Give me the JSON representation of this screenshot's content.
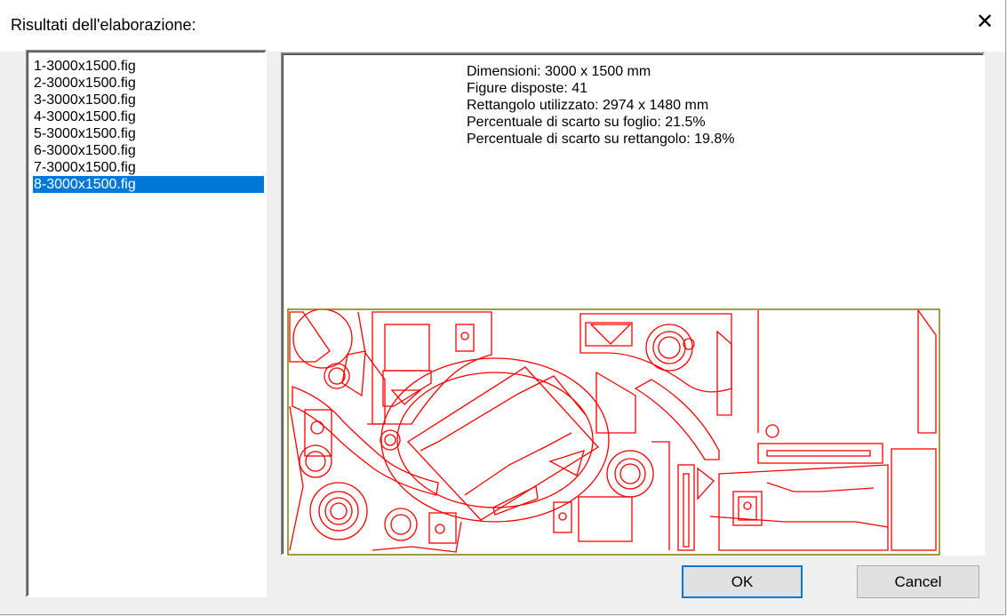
{
  "dialog": {
    "title": "Risultati dell'elaborazione:",
    "close_glyph": "✕"
  },
  "file_list": {
    "items": [
      "1-3000x1500.fig",
      "2-3000x1500.fig",
      "3-3000x1500.fig",
      "4-3000x1500.fig",
      "5-3000x1500.fig",
      "6-3000x1500.fig",
      "7-3000x1500.fig",
      "8-3000x1500.fig"
    ],
    "selected_index": 7
  },
  "preview": {
    "dimensions": "Dimensioni: 3000 x 1500 mm",
    "figures": "Figure disposte: 41",
    "rectangle_used": "Rettangolo utilizzato: 2974 x 1480 mm",
    "waste_sheet": "Percentuale di scarto su foglio: 21.5%",
    "waste_rect": "Percentuale di scarto su rettangolo: 19.8%",
    "sheet_border_color": "#808000",
    "shape_color": "#ff0000"
  },
  "buttons": {
    "ok": "OK",
    "cancel": "Cancel"
  }
}
